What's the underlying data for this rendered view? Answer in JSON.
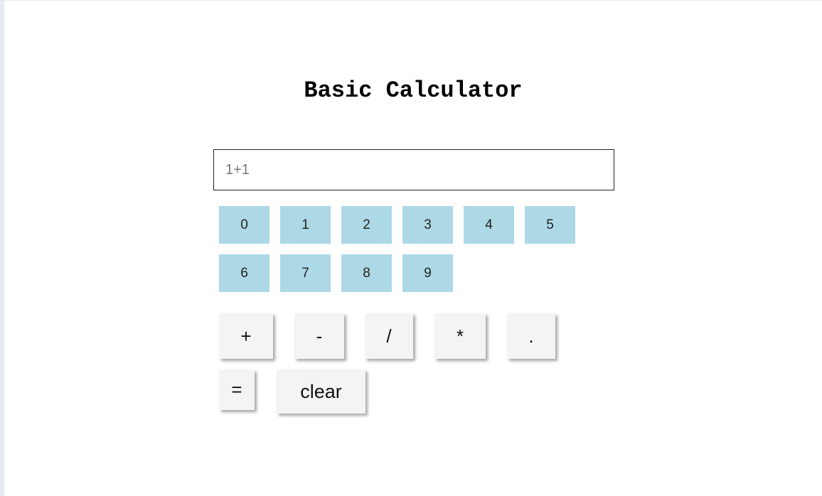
{
  "title": "Basic Calculator",
  "display": {
    "placeholder": "1+1",
    "value": ""
  },
  "digits": [
    "0",
    "1",
    "2",
    "3",
    "4",
    "5",
    "6",
    "7",
    "8",
    "9"
  ],
  "operators": {
    "plus": "+",
    "minus": "-",
    "divide": "/",
    "multiply": "*",
    "dot": "."
  },
  "equals": "=",
  "clear": "clear",
  "colors": {
    "digit_bg": "#add8e6",
    "op_bg": "#f4f4f4",
    "background": "#ffffff"
  }
}
